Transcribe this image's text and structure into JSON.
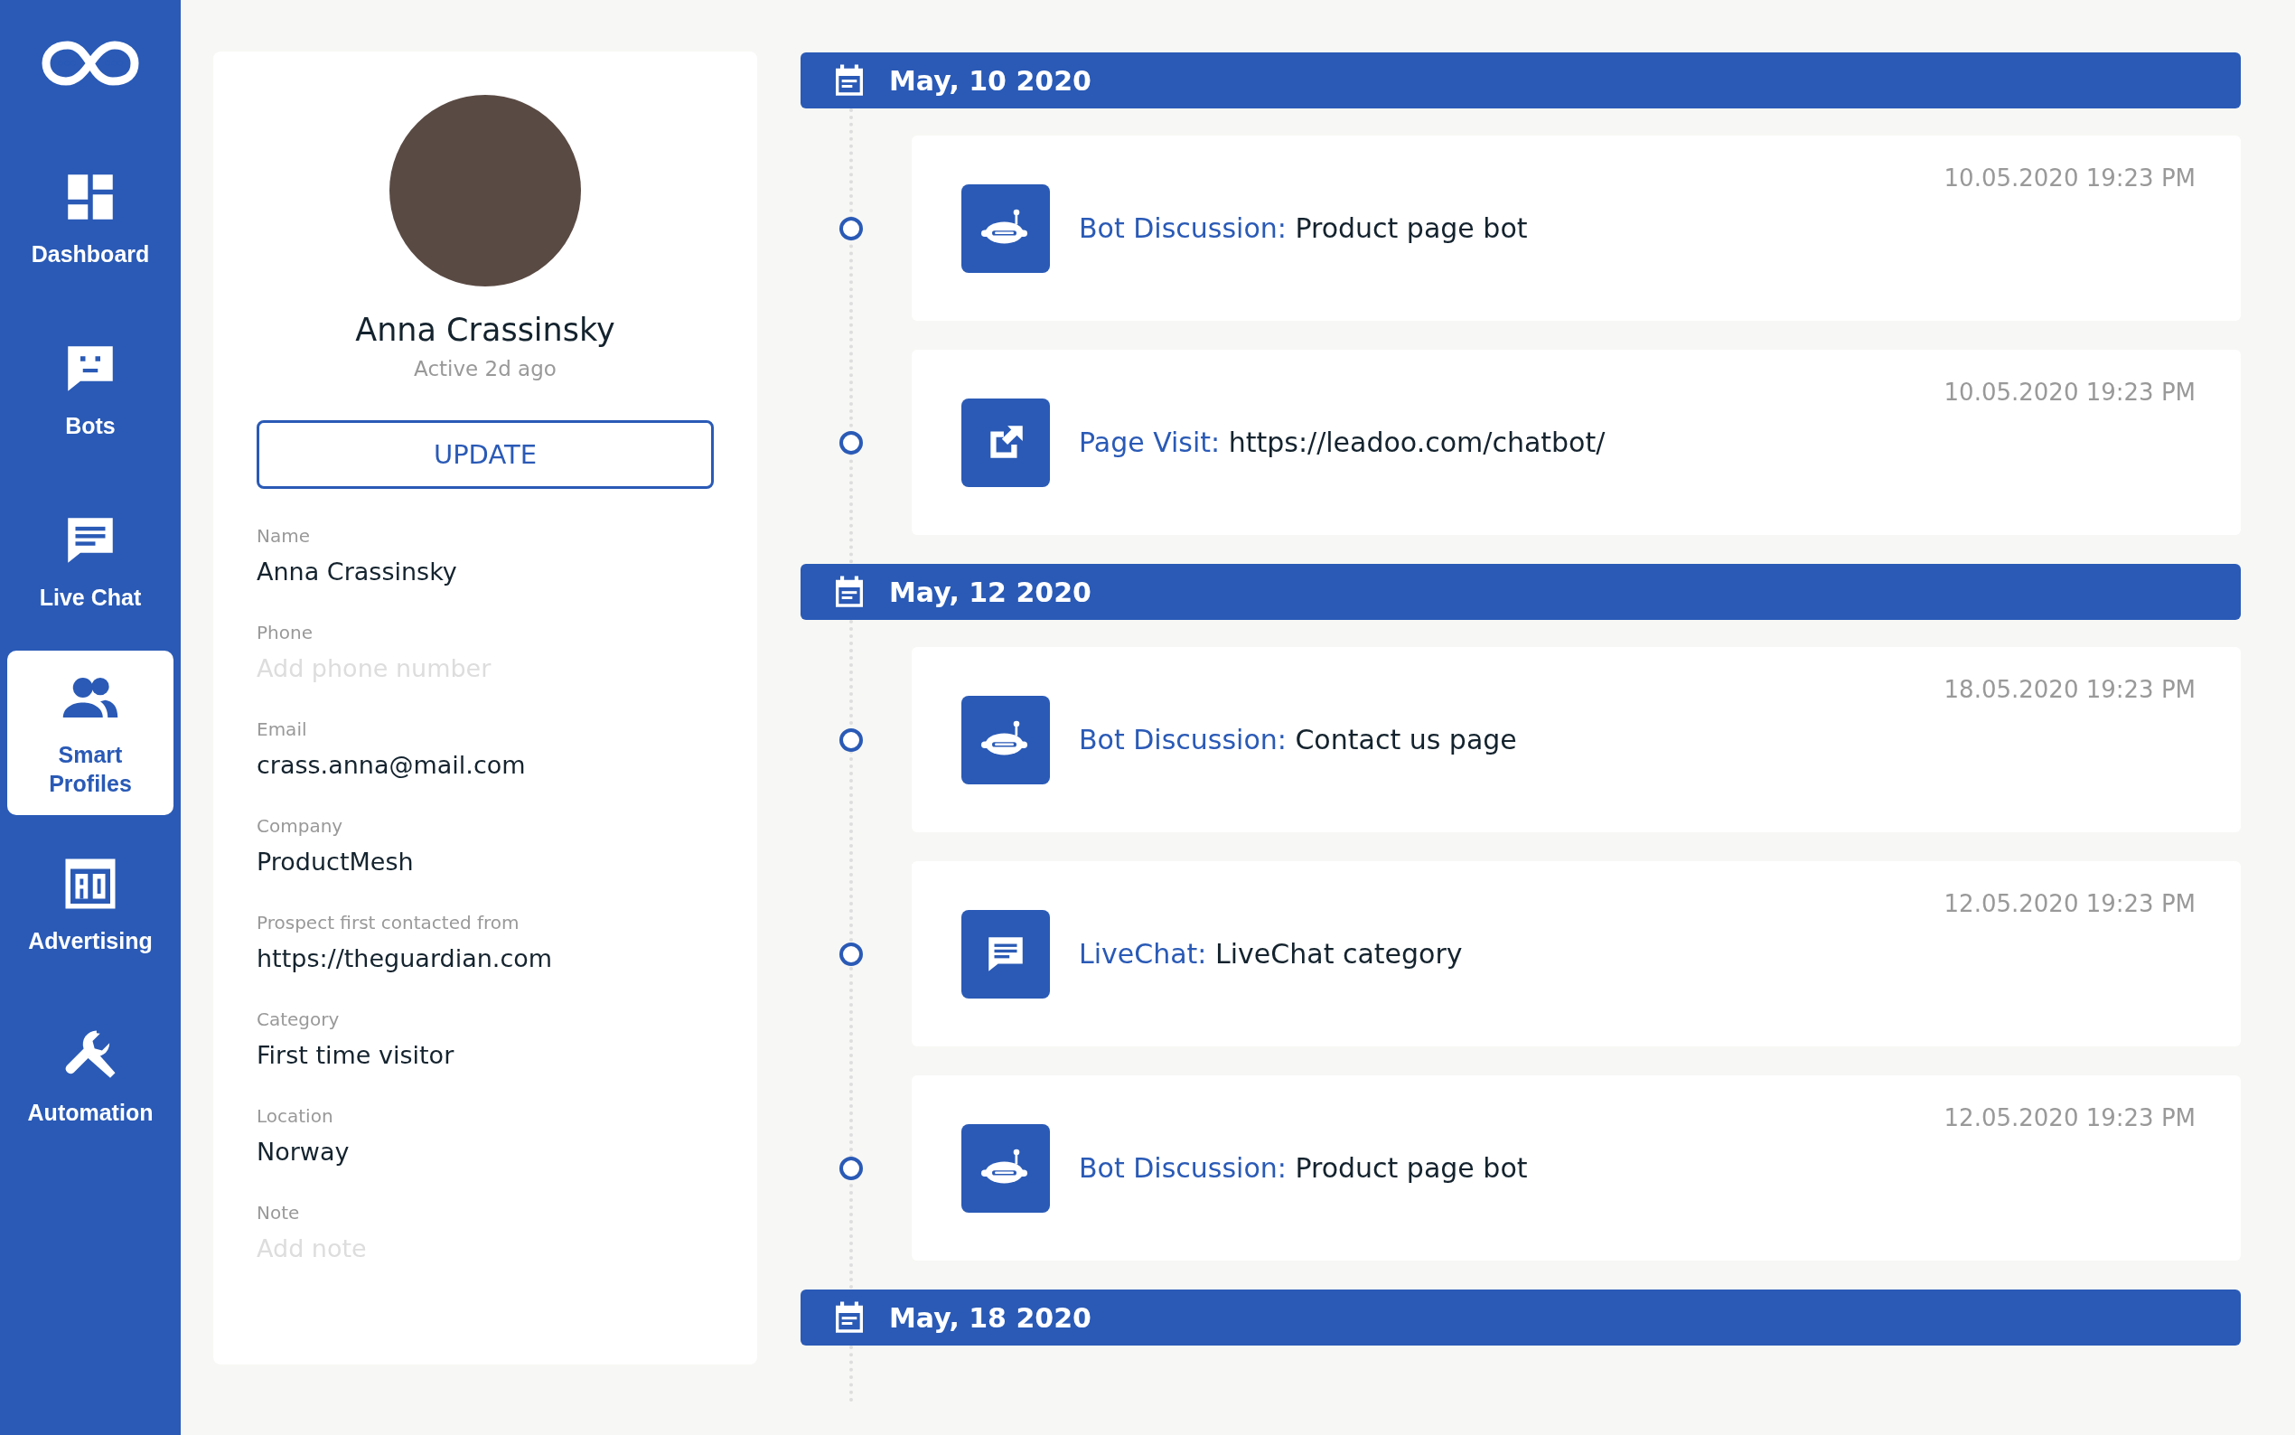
{
  "sidebar": {
    "items": [
      {
        "label": "Dashboard",
        "kind": "dashboard",
        "selected": false
      },
      {
        "label": "Bots",
        "kind": "bots",
        "selected": false
      },
      {
        "label": "Live Chat",
        "kind": "livechat",
        "selected": false
      },
      {
        "label": "Smart Profiles",
        "kind": "profiles",
        "selected": true
      },
      {
        "label": "Advertising",
        "kind": "advertising",
        "selected": false
      },
      {
        "label": "Automation",
        "kind": "automation",
        "selected": false
      }
    ]
  },
  "profile": {
    "name": "Anna Crassinsky",
    "status": "Active 2d ago",
    "button": "UPDATE",
    "fields": [
      {
        "label": "Name",
        "value": "Anna Crassinsky"
      },
      {
        "label": "Phone",
        "placeholder": "Add phone number"
      },
      {
        "label": "Email",
        "value": "crass.anna@mail.com"
      },
      {
        "label": "Company",
        "value": "ProductMesh"
      },
      {
        "label": "Prospect first contacted from",
        "value": "https://theguardian.com"
      },
      {
        "label": "Category",
        "value": "First time visitor"
      },
      {
        "label": "Location",
        "value": "Norway"
      },
      {
        "label": "Note",
        "placeholder": "Add note"
      }
    ]
  },
  "timeline": [
    {
      "date": "May, 10 2020",
      "events": [
        {
          "kind": "bot",
          "type": "Bot Discussion:",
          "text": "Product page bot",
          "time": "10.05.2020 19:23 PM"
        },
        {
          "kind": "page",
          "type": "Page Visit:",
          "text": "https://leadoo.com/chatbot/",
          "time": "10.05.2020 19:23 PM"
        }
      ]
    },
    {
      "date": "May, 12 2020",
      "events": [
        {
          "kind": "bot",
          "type": "Bot Discussion:",
          "text": "Contact us page",
          "time": "18.05.2020 19:23 PM"
        },
        {
          "kind": "livechat",
          "type": "LiveChat:",
          "text": "LiveChat category",
          "time": "12.05.2020 19:23 PM"
        },
        {
          "kind": "bot",
          "type": "Bot Discussion:",
          "text": "Product page bot",
          "time": "12.05.2020 19:23 PM"
        }
      ]
    },
    {
      "date": "May, 18 2020"
    }
  ]
}
